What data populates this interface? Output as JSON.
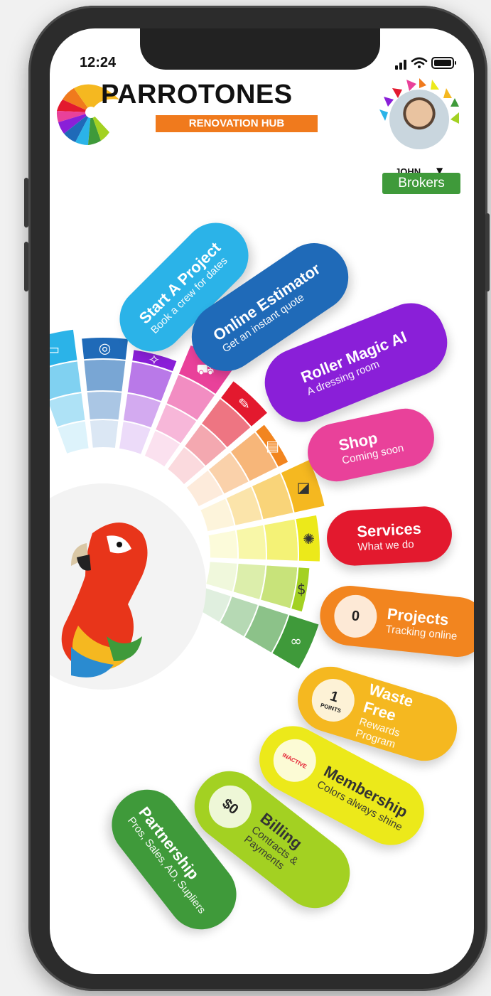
{
  "status_bar": {
    "time": "12:24"
  },
  "header": {
    "brand": "PARROTONES",
    "tagline": "RENOVATION HUB"
  },
  "user": {
    "name": "JOHN",
    "role": "Brokers"
  },
  "menu": [
    {
      "title": "Start A Project",
      "subtitle": "Book a crew for dates",
      "color": "#2bb3e8"
    },
    {
      "title": "Online Estimator",
      "subtitle": "Get an instant quote",
      "color": "#1f6ab8"
    },
    {
      "title": "Roller Magic AI",
      "subtitle": "A dressing room",
      "color": "#8a1fd8"
    },
    {
      "title": "Shop",
      "subtitle": "Coming soon",
      "color": "#e9419a"
    },
    {
      "title": "Services",
      "subtitle": "What we do",
      "color": "#e3192e"
    },
    {
      "title": "Projects",
      "subtitle": "Tracking online",
      "badge": "0",
      "color": "#f2851f"
    },
    {
      "title": "Waste Free",
      "subtitle": "Rewards Program",
      "badge": "1",
      "badge_sub": "POINTS",
      "color": "#f5b820"
    },
    {
      "title": "Membership",
      "subtitle": "Colors always shine",
      "badge": "INACTIVE",
      "color": "#ece91a"
    },
    {
      "title": "Billing",
      "subtitle": "Contracts & Payments",
      "badge": "$0",
      "color": "#a3d122"
    },
    {
      "title": "Partnership",
      "subtitle": "Pros, Sales, AD, Supliers",
      "color": "#3f9a3a"
    }
  ],
  "icons": [
    "calendar-icon",
    "tape-measure-icon",
    "magic-roller-icon",
    "cart-icon",
    "brush-icon",
    "clipboard-icon",
    "bucket-icon",
    "sparkle-icon",
    "dollar-icon",
    "handshake-icon"
  ]
}
